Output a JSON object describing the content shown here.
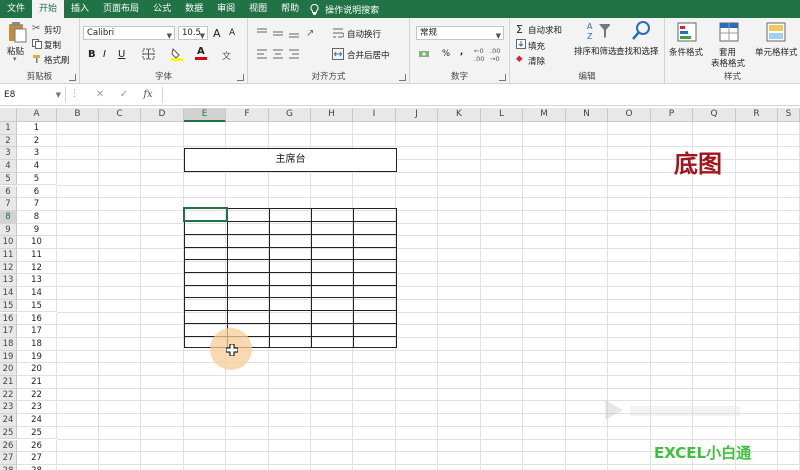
{
  "menu": {
    "tabs": [
      "文件",
      "开始",
      "插入",
      "页面布局",
      "公式",
      "数据",
      "审阅",
      "视图",
      "帮助"
    ],
    "active_tab": "开始",
    "tell_me": "操作说明搜索"
  },
  "ribbon": {
    "clipboard": {
      "paste": "粘贴",
      "cut": "剪切",
      "copy": "复制",
      "format_painter": "格式刷",
      "label": "剪贴板"
    },
    "font": {
      "name": "Calibri",
      "size": "10.5",
      "bold": "B",
      "italic": "I",
      "underline": "U",
      "grow": "A",
      "shrink": "A",
      "label": "字体"
    },
    "alignment": {
      "wrap": "自动换行",
      "merge": "合并后居中",
      "label": "对齐方式"
    },
    "number": {
      "format": "常规",
      "percent": "%",
      "comma": ",",
      "label": "数字"
    },
    "editing": {
      "autosum": "自动求和",
      "fill": "填充",
      "clear": "清除",
      "sort": "排序和筛选",
      "find": "查找和选择",
      "label": "编辑"
    },
    "styles": {
      "conditional": "条件格式",
      "table": "套用",
      "table2": "表格格式",
      "cell_styles": "单元格样式",
      "label": "样式"
    }
  },
  "formula_bar": {
    "name_box": "E8",
    "cancel": "✕",
    "enter": "✓",
    "fx": "fx",
    "value": ""
  },
  "columns": [
    "A",
    "B",
    "C",
    "D",
    "E",
    "F",
    "G",
    "H",
    "I",
    "J",
    "K",
    "L",
    "M",
    "N",
    "O",
    "P",
    "Q",
    "R",
    "S"
  ],
  "selected_column": "E",
  "rows": [
    1,
    2,
    3,
    4,
    5,
    6,
    7,
    8,
    9,
    10,
    11,
    12,
    13,
    14,
    15,
    16,
    17,
    18,
    19,
    20,
    21,
    22,
    23,
    24,
    25,
    26,
    27,
    28
  ],
  "selected_row": 8,
  "column_a_values": [
    "1",
    "2",
    "3",
    "4",
    "5",
    "6",
    "7",
    "8",
    "9",
    "10",
    "11",
    "12",
    "13",
    "14",
    "15",
    "16",
    "17",
    "18",
    "19",
    "20",
    "21",
    "22",
    "23",
    "24",
    "25",
    "26",
    "27",
    "28"
  ],
  "stage_label": "主席台",
  "overlay_title": "底图",
  "brand": "EXCEL小白通",
  "colors": {
    "excel_green": "#217346",
    "title_red": "#a1141c",
    "brand_green": "#3fbf3f"
  }
}
